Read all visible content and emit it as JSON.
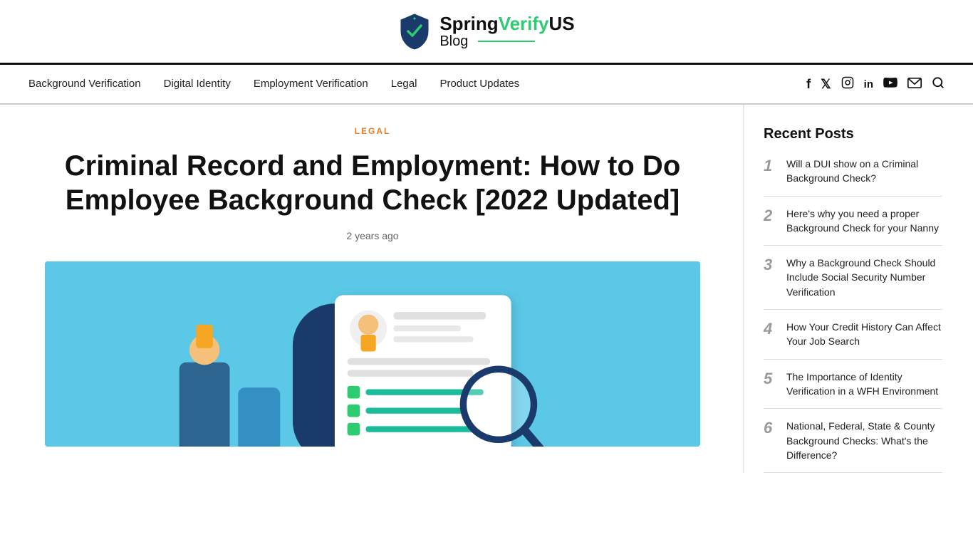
{
  "header": {
    "brand_name": "SpringVerify",
    "brand_us": "US",
    "brand_blog": "Blog"
  },
  "nav": {
    "links": [
      {
        "label": "Background Verification",
        "href": "#"
      },
      {
        "label": "Digital Identity",
        "href": "#"
      },
      {
        "label": "Employment Verification",
        "href": "#"
      },
      {
        "label": "Legal",
        "href": "#"
      },
      {
        "label": "Product Updates",
        "href": "#"
      }
    ],
    "icons": [
      "f",
      "𝕏",
      "⊙",
      "in",
      "▶",
      "✉",
      "🔍"
    ]
  },
  "article": {
    "category": "LEGAL",
    "title": "Criminal Record and Employment: How to Do Employee Background Check [2022 Updated]",
    "meta": "2 years ago"
  },
  "sidebar": {
    "title": "Recent Posts",
    "posts": [
      {
        "number": "1",
        "text": "Will a DUI show on a Criminal Background Check?"
      },
      {
        "number": "2",
        "text": "Here's why you need a proper Background Check for your Nanny"
      },
      {
        "number": "3",
        "text": "Why a Background Check Should Include Social Security Number Verification"
      },
      {
        "number": "4",
        "text": "How Your Credit History Can Affect Your Job Search"
      },
      {
        "number": "5",
        "text": "The Importance of Identity Verification in a WFH Environment"
      },
      {
        "number": "6",
        "text": "National, Federal, State & County Background Checks: What's the Difference?"
      }
    ]
  }
}
